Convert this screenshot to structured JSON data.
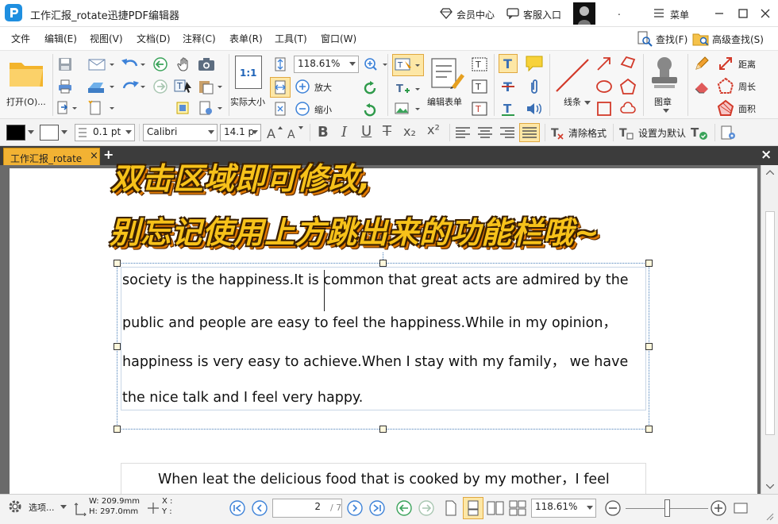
{
  "app": {
    "title": "工作汇报_rotate迅捷PDF编辑器",
    "member_center": "会员中心",
    "customer_service": "客服入口",
    "dot": ".",
    "menu": "菜单"
  },
  "menubar": {
    "items": [
      "文件",
      "编辑(E)",
      "视图(V)",
      "文档(D)",
      "注释(C)",
      "表单(R)",
      "工具(T)",
      "窗口(W)"
    ],
    "search": "查找(F)",
    "advanced_search": "高级查找(S)"
  },
  "ribbon": {
    "open_label": "打开(O)...",
    "zoom_value": "118.61%",
    "zoom_in_label": "放大",
    "zoom_out_label": "缩小",
    "actual_size_label": "实际大小",
    "actual_size_icon_text": "1:1",
    "edit_form_label": "编辑表单",
    "line_label": "线条",
    "stamp_label": "图章",
    "distance_label": "距离",
    "perimeter_label": "周长",
    "area_label": "面积"
  },
  "format": {
    "stroke_width": "0.1 pt",
    "font_name": "Calibri",
    "font_size": "14.1 p",
    "clear_format": "清除格式",
    "set_default": "设置为默认",
    "bold": "B",
    "italic": "I",
    "underline": "U",
    "strike": "T",
    "sub": "x₂",
    "sup": "x²"
  },
  "tab": {
    "name": "工作汇报_rotate",
    "close": "×",
    "add": "+"
  },
  "document": {
    "banner_line1": "双击区域即可修改,",
    "banner_line2": "别忘记使用上方跳出来的功能栏哦~",
    "lines": [
      "society is the happiness.It is common that great acts are admired by the",
      "public and people are easy to feel the happiness.While in my opinion，",
      "happiness is very easy to achieve.When I stay with my family， we have",
      "the nice talk and I feel very happy."
    ],
    "next_line": "When leat the delicious food that is cooked by my mother，I feel"
  },
  "status": {
    "options": "选项...",
    "width": "W: 209.9mm",
    "height": "H: 297.0mm",
    "x": "X :",
    "y": "Y :",
    "page_input": "2",
    "page_total": "/ 7",
    "zoom": "118.61%"
  },
  "colors": {
    "accent_blue": "#1e63b8",
    "banner_yellow": "#f7c21a",
    "tab_orange": "#f2b233"
  }
}
